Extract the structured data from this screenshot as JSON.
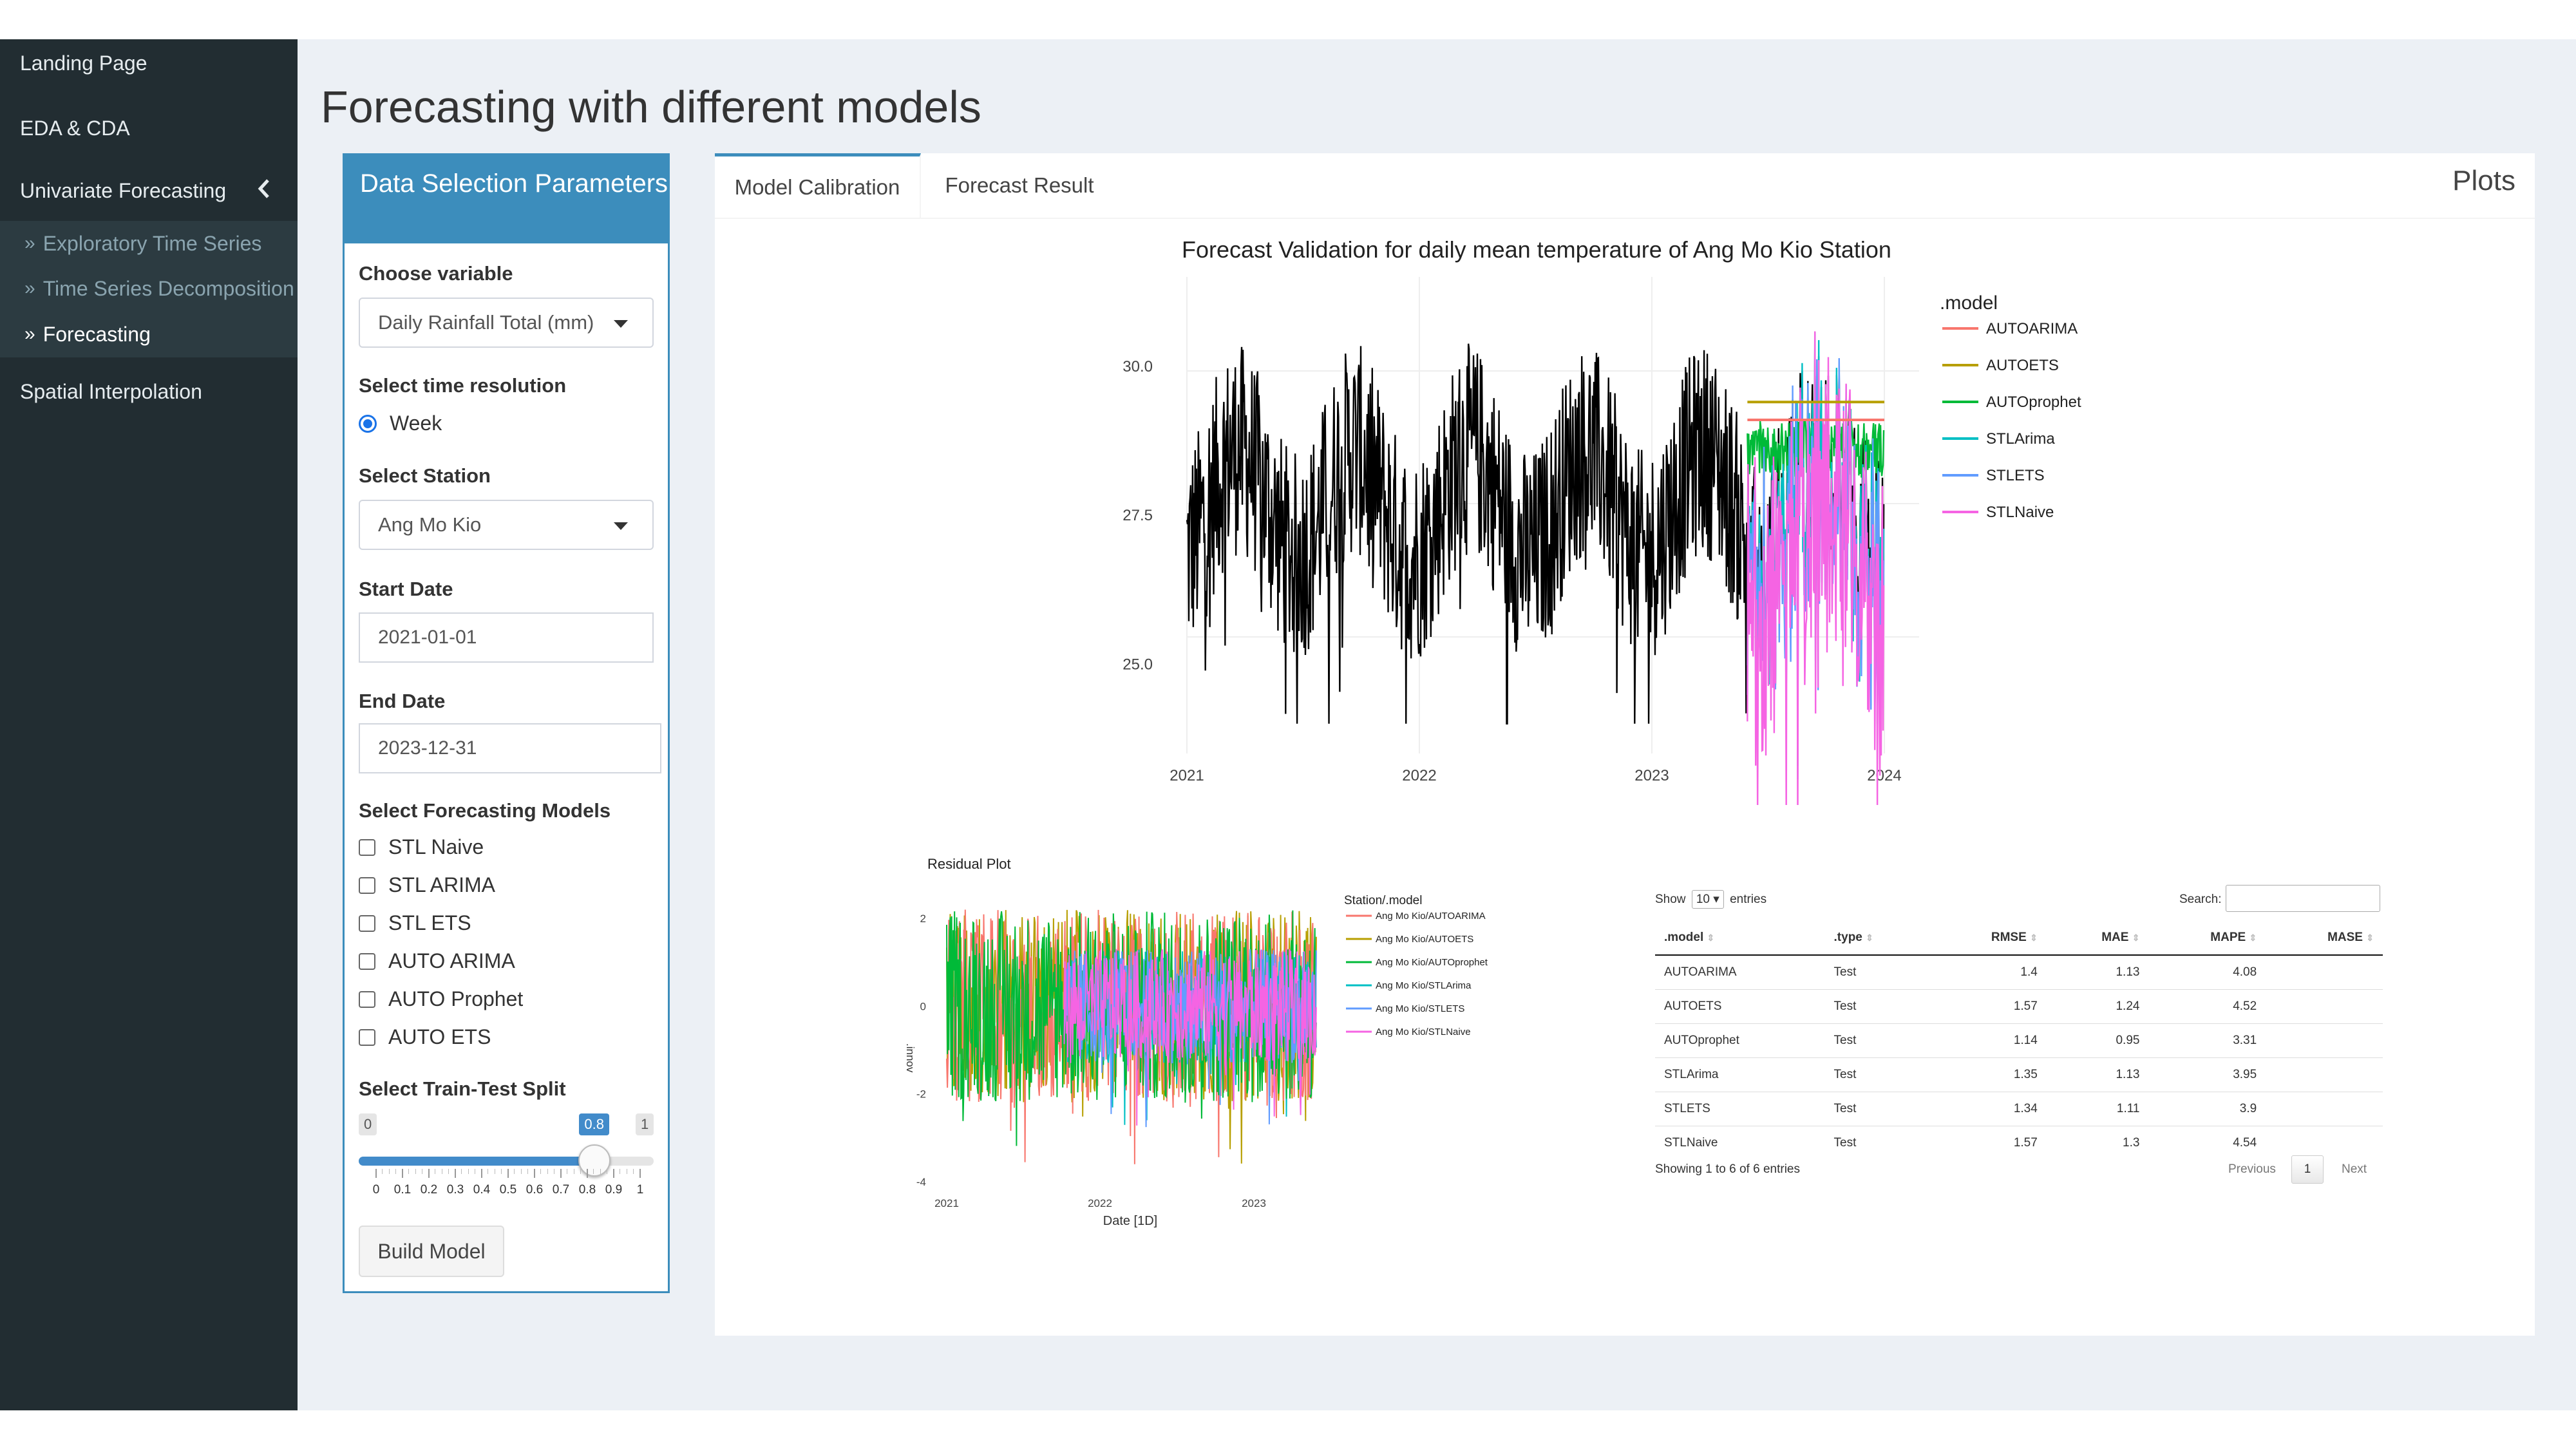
{
  "sidebar": {
    "items": [
      {
        "label": "Landing Page"
      },
      {
        "label": "EDA & CDA"
      },
      {
        "label": "Univariate Forecasting"
      },
      {
        "label": "Exploratory Time Series"
      },
      {
        "label": "Time Series Decomposition"
      },
      {
        "label": "Forecasting"
      },
      {
        "label": "Spatial Interpolation"
      }
    ]
  },
  "page": {
    "title": "Forecasting with different models"
  },
  "params": {
    "header": "Data Selection Parameters",
    "variable_label": "Choose variable",
    "variable_value": "Daily Rainfall Total (mm)",
    "resolution_label": "Select time resolution",
    "resolution_option": "Week",
    "station_label": "Select Station",
    "station_value": "Ang Mo Kio",
    "start_label": "Start Date",
    "start_value": "2021-01-01",
    "end_label": "End Date",
    "end_value": "2023-12-31",
    "models_label": "Select Forecasting Models",
    "models": [
      "STL Naive",
      "STL ARIMA",
      "STL ETS",
      "AUTO ARIMA",
      "AUTO Prophet",
      "AUTO ETS"
    ],
    "split_label": "Select Train-Test Split",
    "split_min": "0",
    "split_max": "1",
    "split_value": "0.8",
    "split_value_num": 0.8,
    "split_ticks": [
      "0",
      "0.1",
      "0.2",
      "0.3",
      "0.4",
      "0.5",
      "0.6",
      "0.7",
      "0.8",
      "0.9",
      "1"
    ],
    "build_button": "Build Model"
  },
  "tabs": {
    "items": [
      "Model Calibration",
      "Forecast Result"
    ],
    "active": 0,
    "panel_title": "Plots"
  },
  "colors": {
    "AUTOARIMA": "#f8766d",
    "AUTOETS": "#b79f00",
    "AUTOprophet": "#00ba38",
    "STLArima": "#00bfc4",
    "STLETS": "#619cff",
    "STLNaive": "#f564e3"
  },
  "chart_data": [
    {
      "type": "line",
      "title": "Forecast Validation for daily mean temperature of Ang Mo Kio Station",
      "x_ticks": [
        "2021",
        "2022",
        "2023",
        "2024"
      ],
      "y_ticks": [
        "25.0",
        "27.5",
        "30.0"
      ],
      "ylim": [
        23.5,
        31.5
      ],
      "legend_title": ".model",
      "legend": [
        "AUTOARIMA",
        "AUTOETS",
        "AUTOprophet",
        "STLArima",
        "STLETS",
        "STLNaive"
      ],
      "series": [
        {
          "name": "AUTOARIMA",
          "x_range": [
            "2023-06",
            "2023-12"
          ],
          "constant": 29.1
        },
        {
          "name": "AUTOETS",
          "x_range": [
            "2023-06",
            "2023-12"
          ],
          "constant": 29.4
        }
      ]
    },
    {
      "type": "line",
      "title": "Residual Plot",
      "xlabel": "Date [1D]",
      "ylabel": ".innov",
      "x_ticks": [
        "2021",
        "2022",
        "2023"
      ],
      "y_ticks": [
        "-4",
        "-2",
        "0",
        "2"
      ],
      "ylim": [
        -4,
        2.6
      ],
      "legend_title": "Station/.model",
      "legend": [
        "Ang Mo Kio/AUTOARIMA",
        "Ang Mo Kio/AUTOETS",
        "Ang Mo Kio/AUTOprophet",
        "Ang Mo Kio/STLArima",
        "Ang Mo Kio/STLETS",
        "Ang Mo Kio/STLNaive"
      ]
    },
    {
      "type": "table",
      "columns": [
        ".model",
        ".type",
        "RMSE",
        "MAE",
        "MAPE",
        "MASE"
      ],
      "rows": [
        [
          "AUTOARIMA",
          "Test",
          "1.4",
          "1.13",
          "4.08",
          ""
        ],
        [
          "AUTOETS",
          "Test",
          "1.57",
          "1.24",
          "4.52",
          ""
        ],
        [
          "AUTOprophet",
          "Test",
          "1.14",
          "0.95",
          "3.31",
          ""
        ],
        [
          "STLArima",
          "Test",
          "1.35",
          "1.13",
          "3.95",
          ""
        ],
        [
          "STLETS",
          "Test",
          "1.34",
          "1.11",
          "3.9",
          ""
        ],
        [
          "STLNaive",
          "Test",
          "1.57",
          "1.3",
          "4.54",
          ""
        ]
      ]
    }
  ],
  "table_ui": {
    "show": "Show",
    "entries_value": "10",
    "entries": "entries",
    "search_label": "Search:",
    "info": "Showing 1 to 6 of 6 entries",
    "previous": "Previous",
    "page": "1",
    "next": "Next"
  }
}
